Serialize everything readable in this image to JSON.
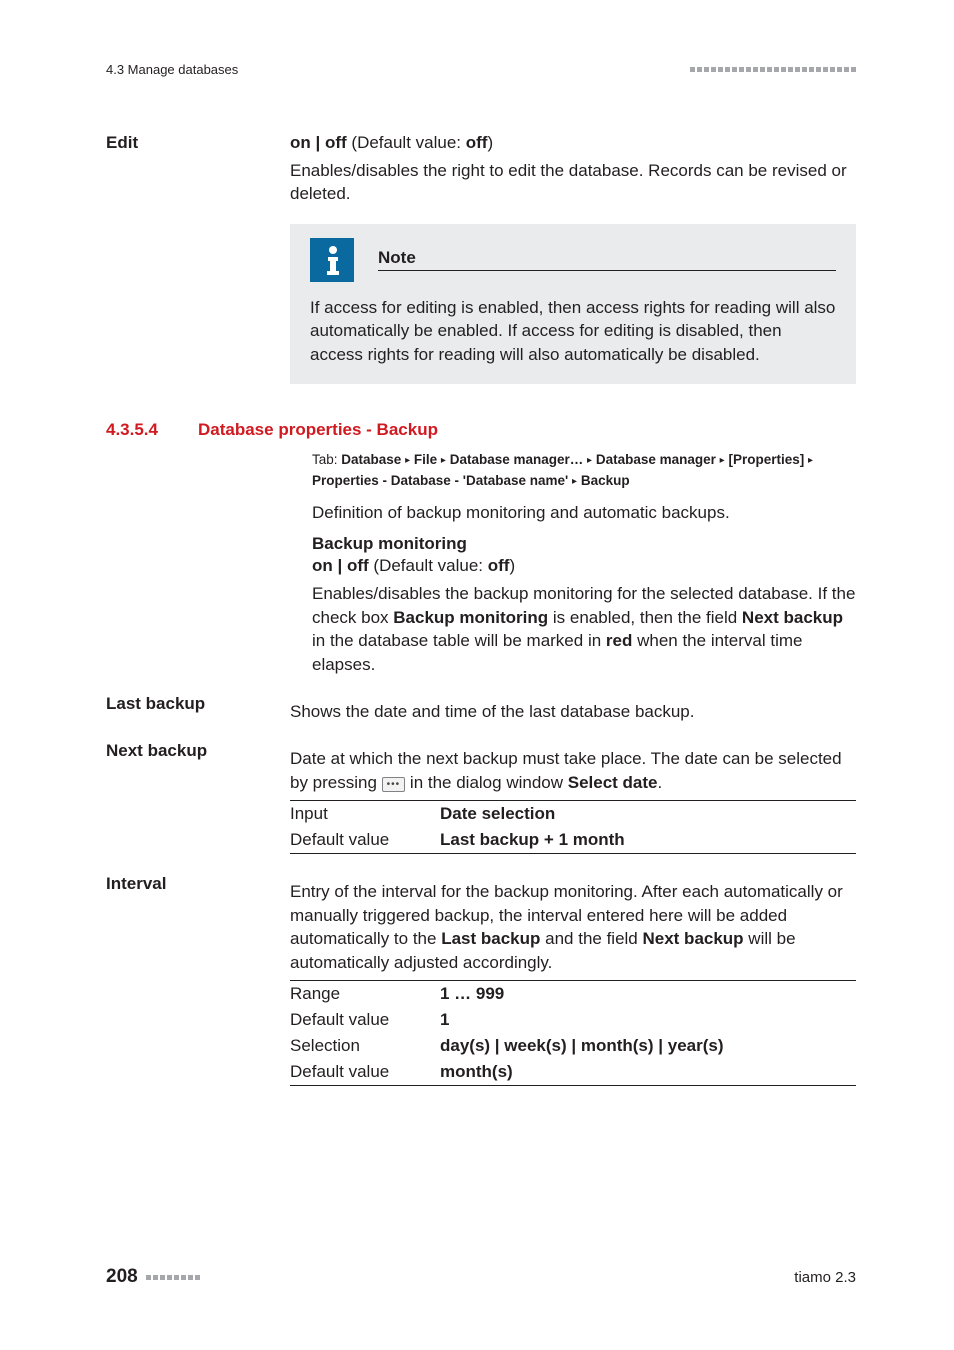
{
  "runhead": {
    "left": "4.3 Manage databases"
  },
  "edit": {
    "label": "Edit",
    "onoff_prefix": "on | off",
    "default_label": " (Default value: ",
    "default_value": "off",
    "default_suffix": ")",
    "description": "Enables/disables the right to edit the database. Records can be revised or deleted."
  },
  "note": {
    "title": "Note",
    "body": "If access for editing is enabled, then access rights for reading will also automatically be enabled. If access for editing is disabled, then access rights for reading will also automatically be disabled."
  },
  "section": {
    "number": "4.3.5.4",
    "title": "Database properties - Backup",
    "tab_prefix": "Tab: ",
    "tab_parts": [
      "Database",
      "File",
      "Database manager…",
      "Database manager",
      "[Properties]",
      "Properties - Database - 'Database name'",
      "Backup"
    ],
    "intro": "Definition of backup monitoring and automatic backups."
  },
  "backup_mon": {
    "heading": "Backup monitoring",
    "onoff_prefix": "on | off",
    "default_label": " (Default value: ",
    "default_value": "off",
    "default_suffix": ")",
    "desc_a": "Enables/disables the backup monitoring for the selected database. If the check box ",
    "desc_b": "Backup monitoring",
    "desc_c": " is enabled, then the field ",
    "desc_d": "Next backup",
    "desc_e": " in the database table will be marked in ",
    "desc_f": "red",
    "desc_g": " when the interval time elapses."
  },
  "last_backup": {
    "label": "Last backup",
    "text": "Shows the date and time of the last database backup."
  },
  "next_backup": {
    "label": "Next backup",
    "text_a": "Date at which the next backup must take place. The date can be selected by pressing ",
    "text_b": " in the dialog window ",
    "text_c": "Select date",
    "text_d": ".",
    "rows": [
      {
        "k": "Input",
        "v": "Date selection"
      },
      {
        "k": "Default value",
        "v": "Last backup + 1 month"
      }
    ]
  },
  "interval": {
    "label": "Interval",
    "text_a": "Entry of the interval for the backup monitoring. After each automatically or manually triggered backup, the interval entered here will be added automatically to the ",
    "text_b": "Last backup",
    "text_c": " and the field ",
    "text_d": "Next backup",
    "text_e": " will be automatically adjusted accordingly.",
    "rows": [
      {
        "k": "Range",
        "v": "1 … 999"
      },
      {
        "k": "Default value",
        "v": "1"
      },
      {
        "k": "Selection",
        "v": "day(s) | week(s) | month(s) | year(s)"
      },
      {
        "k": "Default value",
        "v": "month(s)"
      }
    ]
  },
  "footer": {
    "page": "208",
    "right": "tiamo 2.3"
  }
}
